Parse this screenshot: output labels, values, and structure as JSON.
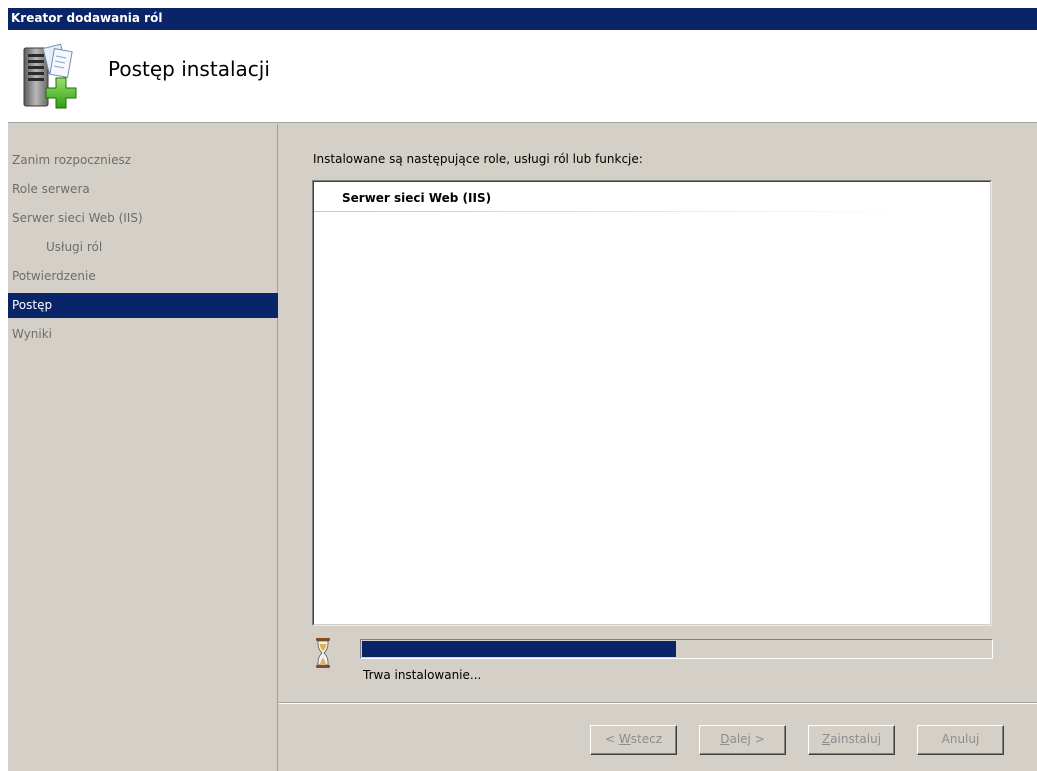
{
  "window": {
    "title": "Kreator dodawania ról"
  },
  "header": {
    "title": "Postęp instalacji",
    "icon": "server-add-icon"
  },
  "sidebar": {
    "items": [
      {
        "label": "Zanim rozpoczniesz",
        "selected": false,
        "indent": false
      },
      {
        "label": "Role serwera",
        "selected": false,
        "indent": false
      },
      {
        "label": "Serwer sieci Web (IIS)",
        "selected": false,
        "indent": false
      },
      {
        "label": "Usługi ról",
        "selected": false,
        "indent": true
      },
      {
        "label": "Potwierdzenie",
        "selected": false,
        "indent": false
      },
      {
        "label": "Postęp",
        "selected": true,
        "indent": false
      },
      {
        "label": "Wyniki",
        "selected": false,
        "indent": false
      }
    ]
  },
  "main": {
    "intro": "Instalowane są następujące role, usługi ról lub funkcje:",
    "roles": [
      "Serwer sieci Web (IIS)"
    ],
    "progress": {
      "percent": 50,
      "status": "Trwa instalowanie..."
    }
  },
  "footer": {
    "back": {
      "pre": "< ",
      "key": "W",
      "post": "stecz"
    },
    "next": {
      "pre": "",
      "key": "D",
      "post": "alej >"
    },
    "install": {
      "pre": "",
      "key": "Z",
      "post": "ainstaluj"
    },
    "cancel": {
      "pre": "",
      "key": "",
      "post": "Anuluj"
    }
  },
  "colors": {
    "selection": "#0a246a",
    "titlebar": "#0a246a",
    "face": "#d4d0c8",
    "disabled_text": "#8d8d8d"
  }
}
